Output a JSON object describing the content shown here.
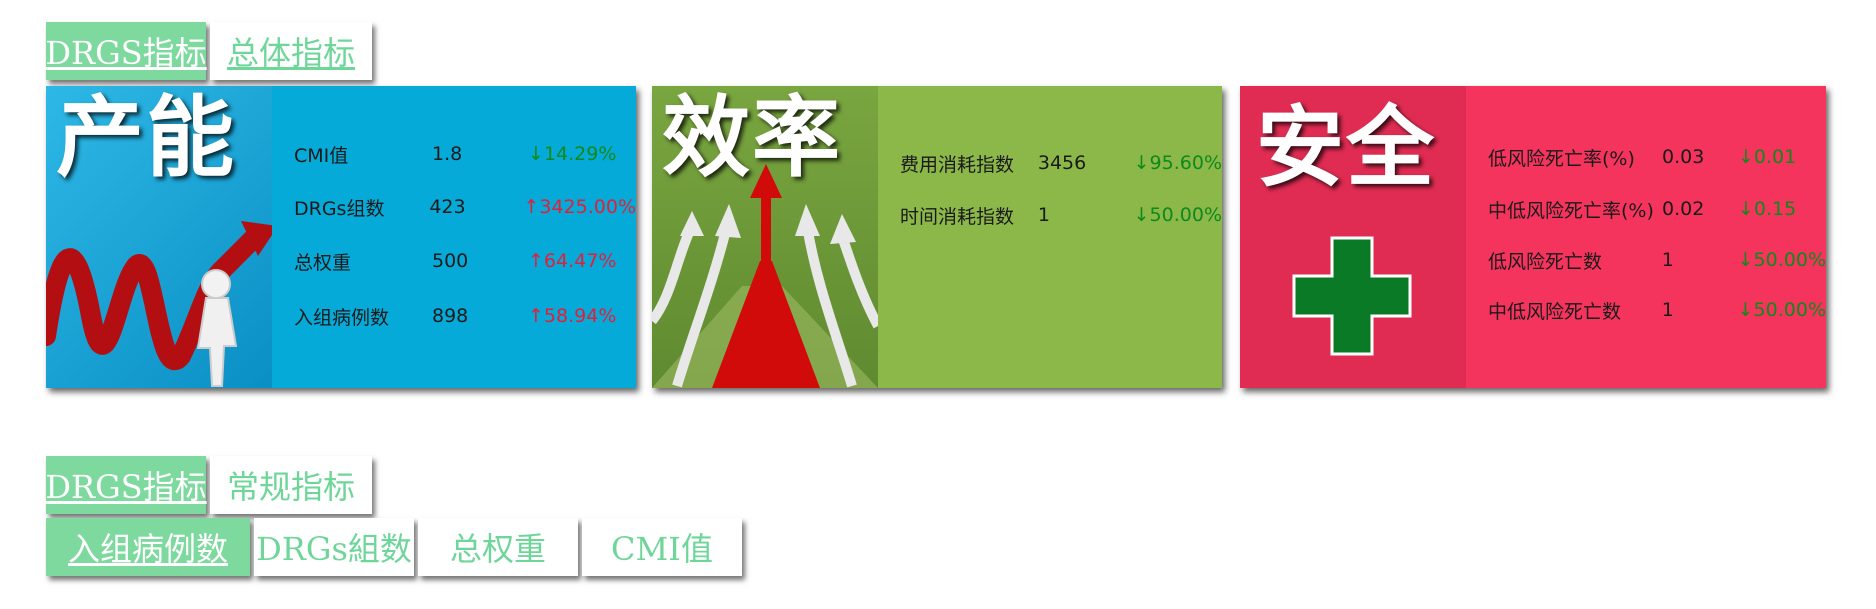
{
  "top_tabs": [
    {
      "label": "DRGS指标",
      "active": true
    },
    {
      "label": "总体指标",
      "active": false
    }
  ],
  "cards": {
    "capacity": {
      "title": "产能",
      "color": "#06aad8",
      "hero_color": "#0a8fc4",
      "rows": [
        {
          "name": "CMI值",
          "value": "1.8",
          "change": "↓14.29%",
          "trend": "down"
        },
        {
          "name": "DRGs组数",
          "value": "423",
          "change": "↑3425.00%",
          "trend": "up"
        },
        {
          "name": "总权重",
          "value": "500",
          "change": "↑64.47%",
          "trend": "up"
        },
        {
          "name": "入组病例数",
          "value": "898",
          "change": "↑58.94%",
          "trend": "up"
        }
      ]
    },
    "efficiency": {
      "title": "效率",
      "color": "#8cb84a",
      "hero_color": "#6f9a3a",
      "rows": [
        {
          "name": "费用消耗指数",
          "value": "3456",
          "change": "↓95.60%",
          "trend": "down"
        },
        {
          "name": "时间消耗指数",
          "value": "1",
          "change": "↓50.00%",
          "trend": "down"
        }
      ]
    },
    "safety": {
      "title": "安全",
      "color": "#f5345e",
      "hero_color": "#e02c52",
      "rows": [
        {
          "name": "低风险死亡率(%)",
          "value": "0.03",
          "change": "↓0.01",
          "trend": "down"
        },
        {
          "name": "中低风险死亡率(%)",
          "value": "0.02",
          "change": "↓0.15",
          "trend": "down"
        },
        {
          "name": "低风险死亡数",
          "value": "1",
          "change": "↓50.00%",
          "trend": "down"
        },
        {
          "name": "中低风险死亡数",
          "value": "1",
          "change": "↓50.00%",
          "trend": "down"
        }
      ]
    }
  },
  "second_tabs": [
    {
      "label": "DRGS指标",
      "active": true
    },
    {
      "label": "常规指标",
      "active": false
    }
  ],
  "metric_tabs": [
    {
      "label": "入组病例数",
      "active": true
    },
    {
      "label": "DRGs組数",
      "active": false
    },
    {
      "label": "总权重",
      "active": false
    },
    {
      "label": "CMI值",
      "active": false
    }
  ]
}
